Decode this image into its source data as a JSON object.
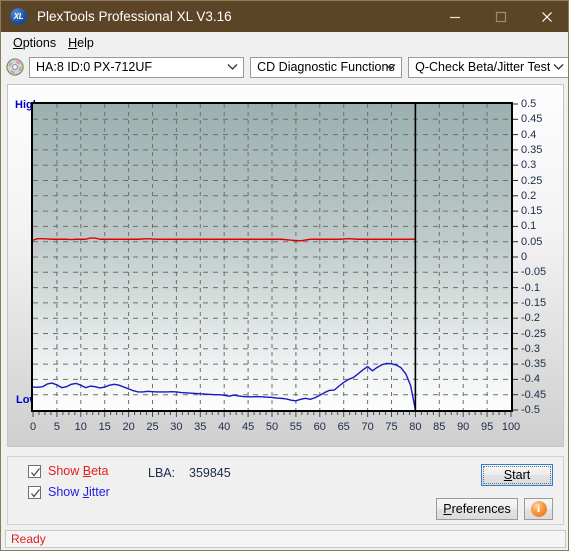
{
  "window": {
    "title": "PlexTools Professional XL V3.16",
    "icon": "xl-disc-icon",
    "minimize": "minimize-icon",
    "maximize": "maximize-icon",
    "close": "close-icon"
  },
  "menu": {
    "items": [
      {
        "label": "Options",
        "accel": "O"
      },
      {
        "label": "Help",
        "accel": "H"
      }
    ]
  },
  "toolbar": {
    "drive_icon": "cd-disc-icon",
    "drive": "HA:8 ID:0  PX-712UF",
    "function": "CD Diagnostic Functions",
    "test": "Q-Check Beta/Jitter Test"
  },
  "controls": {
    "show_beta_label_pre": "Show ",
    "show_beta_accel": "B",
    "show_beta_label_post": "eta",
    "show_beta_checked": true,
    "show_jitter_label_pre": "Show ",
    "show_jitter_accel": "J",
    "show_jitter_label_post": "itter",
    "show_jitter_checked": true,
    "lba_label": "LBA:",
    "lba_value": "359845",
    "start_pre": "",
    "start_accel": "S",
    "start_post": "tart",
    "preferences_pre": "",
    "preferences_accel": "P",
    "preferences_post": "references",
    "info_icon": "info-icon",
    "info_glyph": "i"
  },
  "status": {
    "text": "Ready"
  },
  "chart_data": {
    "type": "line",
    "title": "Q-Check Beta/Jitter Test",
    "xlabel": "",
    "ylabel": "",
    "xlim": [
      0,
      100
    ],
    "ylim": [
      -0.5,
      0.5
    ],
    "grid": true,
    "legend": "none",
    "left_axis_labels": {
      "high": "High",
      "low": "Low"
    },
    "xticks": [
      0,
      5,
      10,
      15,
      20,
      25,
      30,
      35,
      40,
      45,
      50,
      55,
      60,
      65,
      70,
      75,
      80,
      85,
      90,
      95,
      100
    ],
    "yticks": [
      0.5,
      0.45,
      0.4,
      0.35,
      0.3,
      0.25,
      0.2,
      0.15,
      0.1,
      0.05,
      0,
      -0.05,
      -0.1,
      -0.15,
      -0.2,
      -0.25,
      -0.3,
      -0.35,
      -0.4,
      -0.45,
      -0.5
    ],
    "ytick_labels": [
      "0.5",
      "0.45",
      "0.4",
      "0.35",
      "0.3",
      "0.25",
      "0.2",
      "0.15",
      "0.1",
      "0.05",
      "0",
      "-0.05",
      "-0.1",
      "-0.15",
      "-0.2",
      "-0.25",
      "-0.3",
      "-0.35",
      "-0.4",
      "-0.45",
      "-0.5"
    ],
    "cursor_x": 80,
    "cursor_color": "#000000",
    "series": [
      {
        "name": "Beta",
        "color": "#e00000",
        "x": [
          0,
          1,
          2,
          3,
          4,
          5,
          6,
          7,
          8,
          9,
          10,
          11,
          12,
          13,
          14,
          15,
          16,
          17,
          18,
          19,
          20,
          22,
          24,
          26,
          28,
          30,
          32,
          34,
          36,
          38,
          40,
          42,
          44,
          46,
          48,
          50,
          52,
          54,
          56,
          58,
          60,
          62,
          64,
          66,
          68,
          70,
          72,
          74,
          76,
          78,
          80
        ],
        "values": [
          0.055,
          0.06,
          0.06,
          0.059,
          0.058,
          0.058,
          0.058,
          0.058,
          0.057,
          0.058,
          0.058,
          0.058,
          0.062,
          0.062,
          0.058,
          0.058,
          0.058,
          0.058,
          0.058,
          0.058,
          0.058,
          0.058,
          0.06,
          0.058,
          0.058,
          0.058,
          0.058,
          0.058,
          0.058,
          0.058,
          0.058,
          0.058,
          0.058,
          0.058,
          0.058,
          0.058,
          0.058,
          0.055,
          0.053,
          0.058,
          0.058,
          0.058,
          0.058,
          0.06,
          0.058,
          0.058,
          0.058,
          0.058,
          0.058,
          0.058,
          0.058
        ]
      },
      {
        "name": "Jitter",
        "color": "#1818c8",
        "x": [
          0,
          1,
          2,
          3,
          4,
          5,
          6,
          7,
          8,
          9,
          10,
          11,
          12,
          13,
          14,
          15,
          16,
          17,
          18,
          19,
          20,
          21,
          22,
          23,
          24,
          25,
          26,
          27,
          28,
          29,
          30,
          31,
          32,
          33,
          34,
          35,
          36,
          37,
          38,
          39,
          40,
          41,
          42,
          43,
          44,
          45,
          46,
          47,
          48,
          49,
          50,
          51,
          52,
          53,
          54,
          55,
          56,
          57,
          58,
          59,
          60,
          61,
          62,
          63,
          64,
          65,
          66,
          67,
          68,
          69,
          70,
          71,
          72,
          73,
          74,
          75,
          76,
          77,
          78,
          79,
          80
        ],
        "values": [
          -0.425,
          -0.426,
          -0.424,
          -0.415,
          -0.412,
          -0.418,
          -0.427,
          -0.424,
          -0.416,
          -0.413,
          -0.419,
          -0.427,
          -0.422,
          -0.424,
          -0.428,
          -0.425,
          -0.419,
          -0.416,
          -0.419,
          -0.425,
          -0.431,
          -0.437,
          -0.441,
          -0.441,
          -0.439,
          -0.44,
          -0.441,
          -0.441,
          -0.441,
          -0.44,
          -0.441,
          -0.443,
          -0.444,
          -0.445,
          -0.446,
          -0.447,
          -0.448,
          -0.449,
          -0.45,
          -0.45,
          -0.452,
          -0.455,
          -0.451,
          -0.454,
          -0.456,
          -0.457,
          -0.457,
          -0.456,
          -0.457,
          -0.458,
          -0.459,
          -0.461,
          -0.462,
          -0.464,
          -0.468,
          -0.47,
          -0.465,
          -0.462,
          -0.465,
          -0.46,
          -0.452,
          -0.443,
          -0.436,
          -0.435,
          -0.422,
          -0.41,
          -0.4,
          -0.394,
          -0.382,
          -0.369,
          -0.358,
          -0.372,
          -0.361,
          -0.352,
          -0.348,
          -0.349,
          -0.353,
          -0.362,
          -0.382,
          -0.42,
          -0.5
        ]
      }
    ]
  }
}
